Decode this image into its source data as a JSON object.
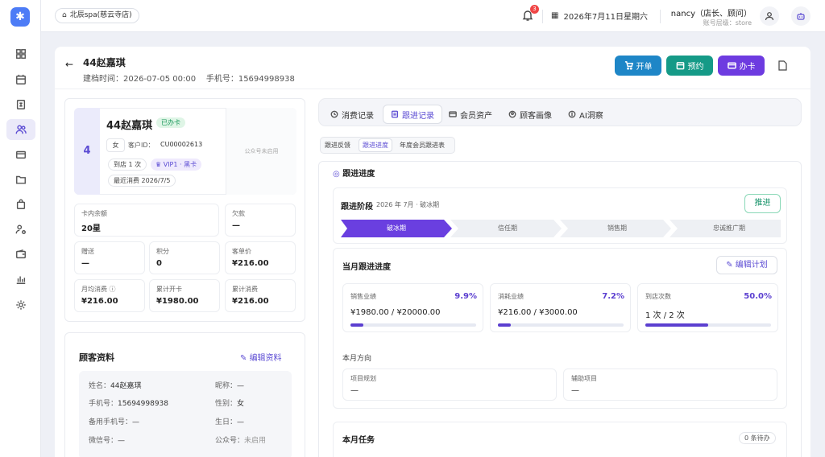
{
  "topbar": {
    "store": "北辰spa(慈云寺店)",
    "notif_count": "3",
    "date": "2026年7月11日星期六",
    "user_name": "nancy（店长、顾问）",
    "user_role": "账号层级：store"
  },
  "header": {
    "title": "44赵嘉琪",
    "meta": "建档时间：2026-07-05 00:00    手机号：15694998938",
    "btn_order": "开单",
    "btn_booking": "预约",
    "btn_card": "办卡"
  },
  "profile": {
    "level_number": "4",
    "name": "44赵嘉琪",
    "card_status": "已办卡",
    "gender": "女",
    "customer_id_label": "客户ID：",
    "customer_id": "CU00002613",
    "visit_count": "到店 1 次",
    "vip": "VIP1 · 黑卡",
    "last_consume": "最近消费 2026/7/5",
    "wechat_public": "公众号未启用"
  },
  "stats": [
    {
      "label": "卡内余额",
      "value": "20星"
    },
    {
      "label": "欠款",
      "value": "—"
    },
    {
      "label": "赠送",
      "value": "—"
    },
    {
      "label": "积分",
      "value": "0"
    },
    {
      "label": "客单价",
      "value": "¥216.00"
    },
    {
      "label": "月均消费",
      "value": "¥216.00"
    },
    {
      "label": "累计开卡",
      "value": "¥1980.00"
    },
    {
      "label": "累计消费",
      "value": "¥216.00"
    }
  ],
  "customer_info": {
    "title": "顾客资料",
    "edit": "编辑资料",
    "rows": [
      {
        "k": "姓名：",
        "v": "44赵嘉琪",
        "k2": "昵称：",
        "v2": "—"
      },
      {
        "k": "手机号：",
        "v": "15694998938",
        "k2": "性别：",
        "v2": "女"
      },
      {
        "k": "备用手机号：",
        "v": "—",
        "k2": "生日：",
        "v2": "—"
      },
      {
        "k": "微信号：",
        "v": "—",
        "k2": "公众号：",
        "v2": "未启用"
      }
    ]
  },
  "tabs": [
    "消费记录",
    "跟进记录",
    "会员资产",
    "顾客画像",
    "AI洞察"
  ],
  "subtabs": [
    "跟进反馈",
    "跟进进度",
    "年度会员跟进表"
  ],
  "progress": {
    "section_title": "跟进进度",
    "stage_title": "跟进阶段",
    "stage_sub": "2026 年 7月 · 破冰期",
    "advance_btn": "推进",
    "stages": [
      "破冰期",
      "信任期",
      "销售期",
      "忠诚推广期"
    ],
    "month_title": "当月跟进进度",
    "edit_plan": "编辑计划",
    "metrics": [
      {
        "label": "销售业绩",
        "pct": "9.9%",
        "value": "¥1980.00 / ¥20000.00",
        "ratio": 0.099
      },
      {
        "label": "消耗业绩",
        "pct": "7.2%",
        "value": "¥216.00 / ¥3000.00",
        "ratio": 0.072
      },
      {
        "label": "到店次数",
        "pct": "50.0%",
        "value": "1 次 / 2 次",
        "ratio": 0.5
      }
    ],
    "direction_title": "本月方向",
    "project_plan_label": "项目规划",
    "project_plan_value": "—",
    "support_label": "辅助项目",
    "support_value": "—",
    "task_title": "本月任务",
    "task_count": "0 条待办"
  }
}
